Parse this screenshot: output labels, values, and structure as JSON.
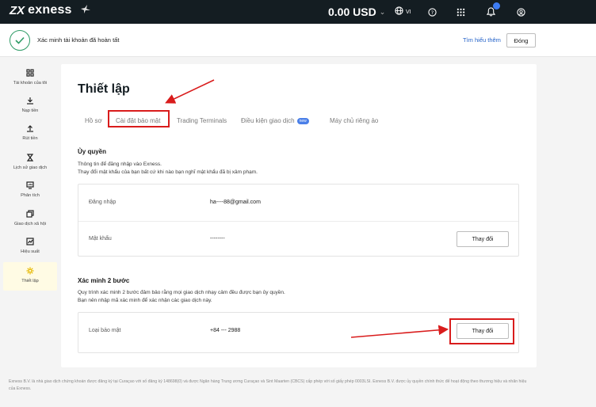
{
  "header": {
    "logo_mark": "ZX",
    "logo_text": "exness",
    "balance": "0.00 USD",
    "balance_chevron": "⌄",
    "language": "VI"
  },
  "banner": {
    "message": "Xác minh tài khoản đã hoàn tất",
    "learn_more": "Tìm hiểu thêm",
    "close_label": "Đóng"
  },
  "sidebar": {
    "items": [
      {
        "label": "Tài khoản của tôi",
        "icon": "grid-icon"
      },
      {
        "label": "Nạp tiền",
        "icon": "download-icon"
      },
      {
        "label": "Rút tiền",
        "icon": "upload-icon"
      },
      {
        "label": "Lịch sử giao dịch",
        "icon": "hourglass-icon"
      },
      {
        "label": "Phân tích",
        "icon": "analytics-icon"
      },
      {
        "label": "Giao dịch xã hội",
        "icon": "social-icon"
      },
      {
        "label": "Hiệu suất",
        "icon": "performance-icon"
      },
      {
        "label": "Thiết lập",
        "icon": "settings-icon"
      }
    ]
  },
  "main": {
    "title": "Thiết lập",
    "tabs": [
      {
        "label": "Hồ sơ"
      },
      {
        "label": "Cài đặt bảo mật"
      },
      {
        "label": "Trading Terminals"
      },
      {
        "label": "Điều kiện giao dịch",
        "badge": "new"
      },
      {
        "label": "Máy chủ riêng ảo"
      }
    ],
    "auth": {
      "title": "Ủy quyền",
      "desc_line1": "Thông tin để đăng nhập vào Exness.",
      "desc_line2": "Thay đổi mật khẩu của bạn bất cứ khi nào bạn nghĩ mật khẩu đã bị xâm phạm.",
      "login_label": "Đăng nhập",
      "login_value": "ha----88@gmail.com",
      "password_label": "Mật khẩu",
      "password_value": "--------",
      "change_label": "Thay đổi"
    },
    "twofa": {
      "title": "Xác minh 2 bước",
      "desc_line1": "Quy trình xác minh 2 bước đảm bảo rằng mọi giao dịch nhạy cảm đều được bạn ủy quyền.",
      "desc_line2": "Bạn nên nhập mã xác minh để xác nhận các giao dịch này.",
      "type_label": "Loại bảo mật",
      "type_value": "+84 --- 2988",
      "change_label": "Thay đổi"
    }
  },
  "footer": {
    "text": "Exness B.V. là nhà giao dịch chứng khoán được đăng ký tại Curaçao với số đăng ký 148698(0) và được Ngân hàng Trung ương Curaçao và Sint Maarten (CBCS) cấp phép với số giấy phép 0003LSI. Exness B.V. được ủy quyền chính thức để hoạt động theo thương hiệu và nhãn hiệu của Exness."
  },
  "colors": {
    "topbar": "#141d22",
    "accent_blue": "#2563c9",
    "annotation_red": "#d91c1c",
    "success_green": "#2e9b66"
  }
}
